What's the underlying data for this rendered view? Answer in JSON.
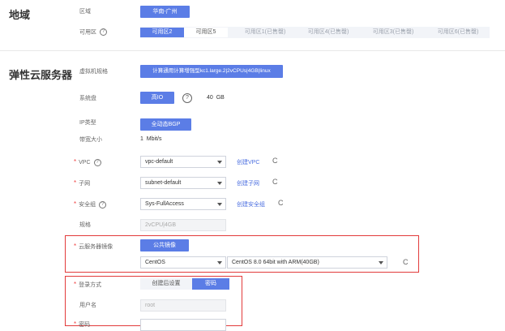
{
  "region": {
    "title": "地域",
    "area_label": "区域",
    "area_value": "华南-广州",
    "zone_label": "可用区",
    "zones": [
      "可用区2",
      "可用区5",
      "可用区1(已售罄)",
      "可用区4(已售罄)",
      "可用区3(已售罄)",
      "可用区6(已售罄)"
    ]
  },
  "ecs": {
    "title": "弹性云服务器",
    "spec_label": "虚拟机规格",
    "spec_value": "计算通用计算增强型kc1.large.2|2vCPUs|4GB|linux",
    "disk_label": "系统盘",
    "disk_type": "高IO",
    "disk_size": "40",
    "disk_unit": "GB",
    "ip_label": "IP类型",
    "ip_value": "全动态BGP",
    "bw_label": "带宽大小",
    "bw_value": "1",
    "bw_unit": "Mbit/s",
    "vpc_label": "VPC",
    "vpc_value": "vpc-default",
    "vpc_link": "创建VPC",
    "subnet_label": "子网",
    "subnet_value": "subnet-default",
    "subnet_link": "创建子网",
    "sg_label": "安全组",
    "sg_value": "Sys-FullAccess",
    "sg_link": "创建安全组",
    "flavor_label": "规格",
    "flavor_value": "2vCPU|4GB",
    "image_label": "云服务器镜像",
    "image_tab": "公共镜像",
    "os_value": "CentOS",
    "os_version": "CentOS 8.0 64bit with ARM(40GB)",
    "login_label": "登录方式",
    "login_tabs": [
      "创建后设置",
      "密码"
    ],
    "user_label": "用户名",
    "user_value": "root",
    "pwd_label": "密码"
  },
  "icons": {
    "help": "?",
    "refresh": "C",
    "required": "*"
  },
  "colors": {
    "accent": "#5b7de6",
    "required": "#f04848",
    "highlight_box": "#e23b3b"
  }
}
